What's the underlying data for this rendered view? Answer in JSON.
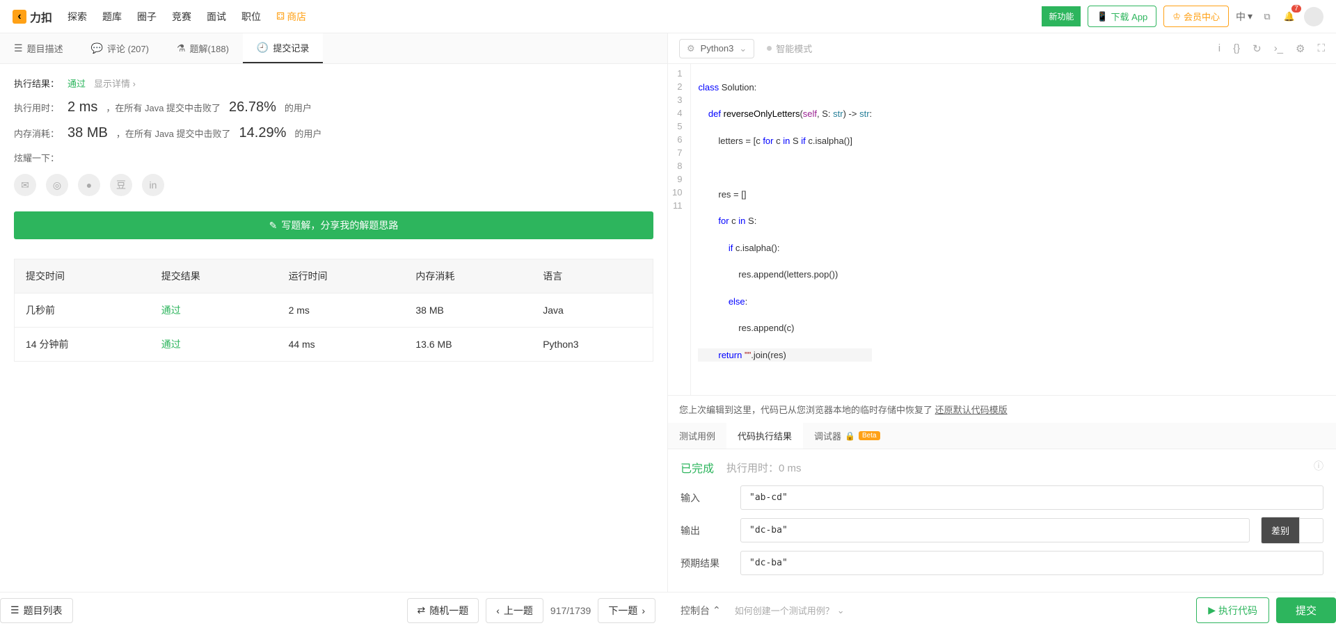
{
  "header": {
    "logo": "力扣",
    "nav": [
      "探索",
      "题库",
      "圈子",
      "竞赛",
      "面试",
      "职位"
    ],
    "store": "商店",
    "new_feature": "新功能",
    "download": "下载 App",
    "member": "会员中心",
    "lang": "中",
    "notif_count": "7"
  },
  "left": {
    "tabs": {
      "desc": "题目描述",
      "comments": "评论 (207)",
      "solutions": "题解(188)",
      "submissions": "提交记录"
    },
    "result": {
      "label": "执行结果：",
      "status": "通过",
      "detail": "显示详情 ›",
      "runtime_label": "执行用时：",
      "runtime": "2 ms",
      "runtime_text": "，在所有 Java 提交中击败了",
      "runtime_pct": "26.78%",
      "runtime_suffix": "的用户",
      "memory_label": "内存消耗：",
      "memory": "38 MB",
      "memory_text": "，在所有 Java 提交中击败了",
      "memory_pct": "14.29%",
      "memory_suffix": "的用户",
      "brag": "炫耀一下：",
      "write_solution": "写题解，分享我的解题思路"
    },
    "table": {
      "headers": [
        "提交时间",
        "提交结果",
        "运行时间",
        "内存消耗",
        "语言"
      ],
      "rows": [
        {
          "time": "几秒前",
          "result": "通过",
          "runtime": "2 ms",
          "memory": "38 MB",
          "lang": "Java"
        },
        {
          "time": "14 分钟前",
          "result": "通过",
          "runtime": "44 ms",
          "memory": "13.6 MB",
          "lang": "Python3"
        }
      ]
    }
  },
  "editor": {
    "language": "Python3",
    "smart_mode": "智能模式",
    "code_lines": [
      "class Solution:",
      "    def reverseOnlyLetters(self, S: str) -> str:",
      "        letters = [c for c in S if c.isalpha()]",
      "",
      "        res = []",
      "        for c in S:",
      "            if c.isalpha():",
      "                res.append(letters.pop())",
      "            else:",
      "                res.append(c)",
      "        return \"\".join(res)"
    ],
    "restore_msg": "您上次编辑到这里，代码已从您浏览器本地的临时存储中恢复了 ",
    "restore_link": "还原默认代码模版"
  },
  "test": {
    "tabs": {
      "cases": "测试用例",
      "result": "代码执行结果",
      "debugger": "调试器",
      "beta": "Beta"
    },
    "status": "已完成",
    "time_label": "执行用时：",
    "time": "0 ms",
    "input_label": "输入",
    "input": "\"ab-cd\"",
    "output_label": "输出",
    "output": "\"dc-ba\"",
    "expected_label": "预期结果",
    "expected": "\"dc-ba\"",
    "diff": "差别"
  },
  "bottom": {
    "list": "题目列表",
    "random": "随机一题",
    "prev": "上一题",
    "counter": "917/1739",
    "next": "下一题",
    "console": "控制台",
    "howto": "如何创建一个测试用例？",
    "run": "执行代码",
    "submit": "提交"
  }
}
